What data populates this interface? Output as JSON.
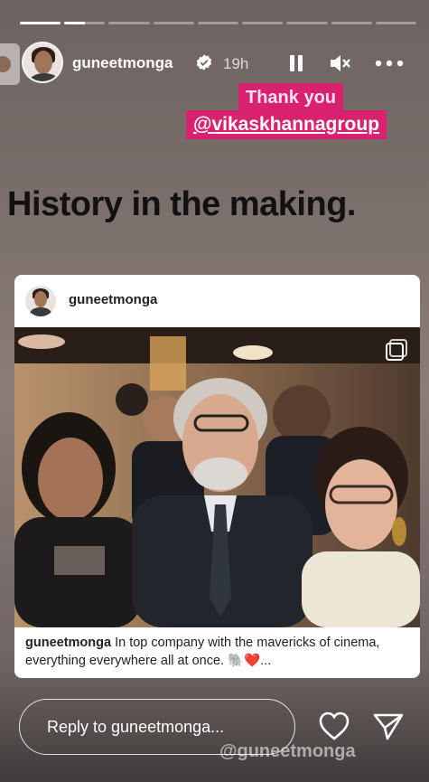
{
  "story": {
    "progress": {
      "segments": 9,
      "active_index": 1,
      "active_fill_pct": 50
    },
    "header": {
      "username": "guneetmonga",
      "time": "19h"
    },
    "sticker": {
      "line1": "Thank you",
      "line2": "@vikaskhannagroup"
    },
    "headline": "History in the making.",
    "post": {
      "username": "guneetmonga",
      "caption_user": "guneetmonga",
      "caption_text": " In top company with the mavericks of cinema, everything everywhere all at once. 🐘❤️..."
    },
    "reply": {
      "placeholder": "Reply to guneetmonga..."
    },
    "watermark": "@guneetmonga"
  },
  "colors": {
    "accent_pink": "#d8226f",
    "verified_blue": "#ffffff"
  }
}
